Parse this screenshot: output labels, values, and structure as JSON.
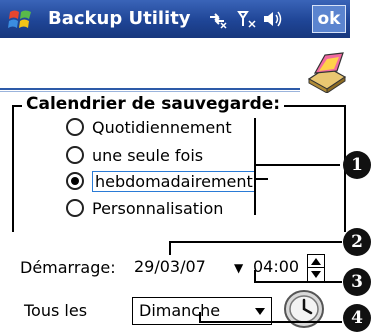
{
  "titlebar": {
    "title": "Backup Utility",
    "ok_label": "ok"
  },
  "group": {
    "legend": "Calendrier de sauvegarde:",
    "options": [
      {
        "label": "Quotidiennement",
        "selected": false
      },
      {
        "label": "une seule fois",
        "selected": false
      },
      {
        "label": "hebdomadairement",
        "selected": true
      },
      {
        "label": "Personnalisation",
        "selected": false
      }
    ]
  },
  "start": {
    "label": "Démarrage:",
    "date": "29/03/07",
    "time": "04:00"
  },
  "repeat": {
    "label": "Tous les",
    "day": "Dimanche"
  },
  "callouts": [
    "1",
    "2",
    "3",
    "4"
  ],
  "colors": {
    "titlebar": "#1f4596",
    "header_line": "#2d5aa8",
    "focus": "#2a7bd6"
  }
}
